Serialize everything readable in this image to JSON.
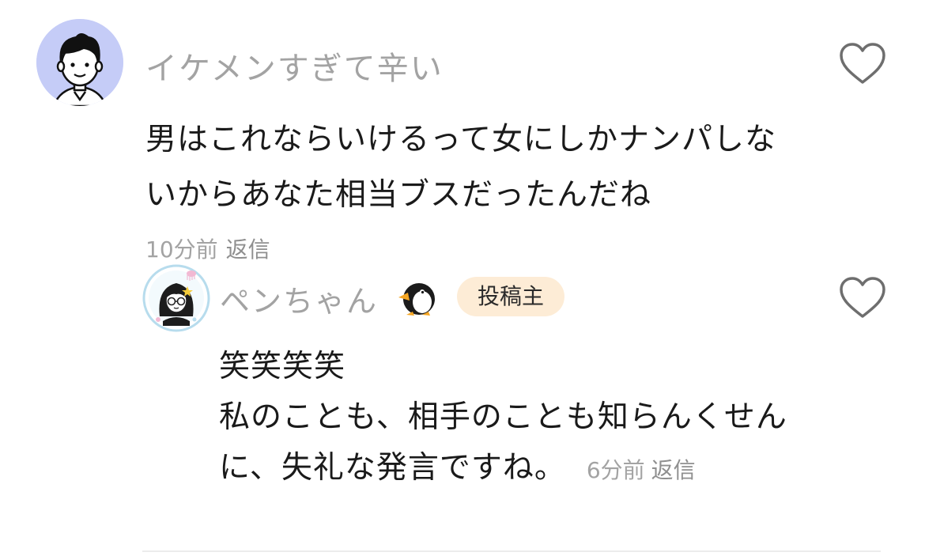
{
  "comment": {
    "username": "イケメンすぎて辛い",
    "body_lines": [
      "男はこれならいけるって女にしかナンパしな",
      "いからあなた相当ブスだったんだね"
    ],
    "time": "10分前",
    "reply_label": "返信",
    "avatar_icon": "man-avatar-icon",
    "avatar_bg": "#c5ccf7",
    "like_icon": "heart-outline-icon"
  },
  "reply": {
    "username": "ペンちゃん",
    "emoji_icon": "penguin-icon",
    "badge": "投稿主",
    "badge_bg": "#fdecd6",
    "body_lines": [
      "笑笑笑笑",
      "私のことも、相手のことも知らんくせん",
      "に、失礼な発言ですね。"
    ],
    "time": "6分前",
    "reply_label": "返信",
    "avatar_icon": "woman-glasses-avatar-icon",
    "like_icon": "heart-outline-icon"
  }
}
